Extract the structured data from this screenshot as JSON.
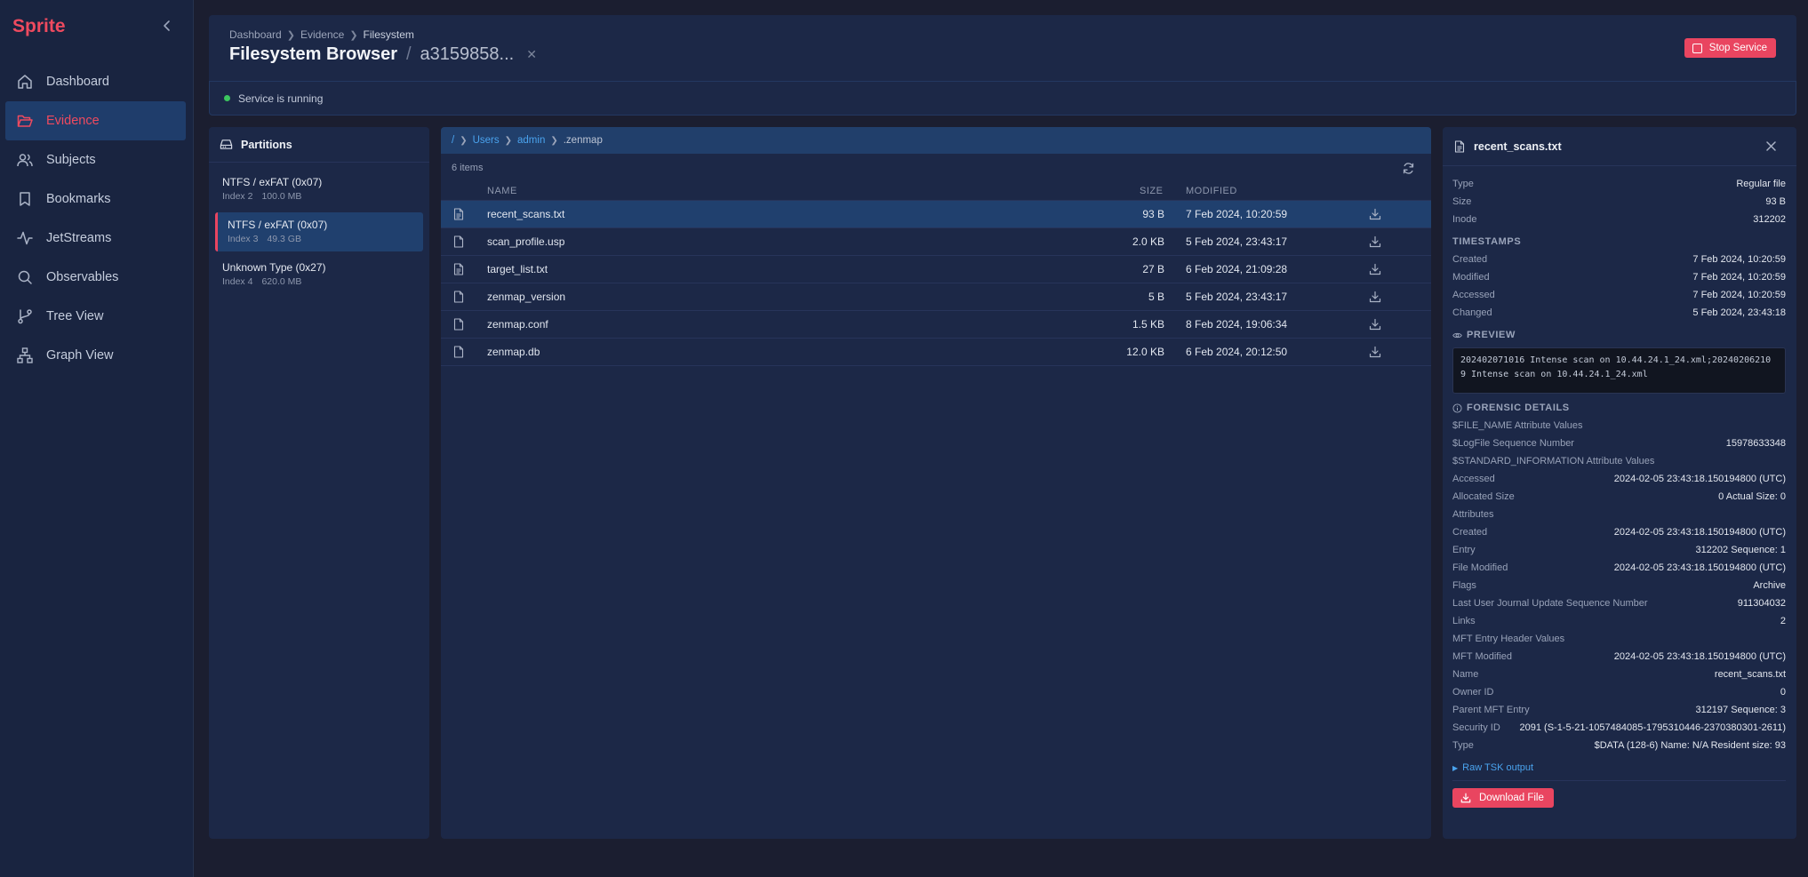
{
  "app": {
    "name": "Sprite"
  },
  "sidebar": {
    "items": [
      {
        "label": "Dashboard",
        "icon": "home-icon"
      },
      {
        "label": "Evidence",
        "icon": "folder-open-icon",
        "active": true
      },
      {
        "label": "Subjects",
        "icon": "users-icon"
      },
      {
        "label": "Bookmarks",
        "icon": "bookmark-icon"
      },
      {
        "label": "JetStreams",
        "icon": "activity-icon"
      },
      {
        "label": "Observables",
        "icon": "search-icon"
      },
      {
        "label": "Tree View",
        "icon": "git-branch-icon"
      },
      {
        "label": "Graph View",
        "icon": "network-icon"
      }
    ]
  },
  "header": {
    "breadcrumb": [
      "Dashboard",
      "Evidence",
      "Filesystem"
    ],
    "title": "Filesystem Browser",
    "evidence_id": "a3159858...",
    "stop_label": "Stop Service"
  },
  "status": {
    "text": "Service is running",
    "color": "#3cc65f"
  },
  "partitions": {
    "title": "Partitions",
    "items": [
      {
        "name": "NTFS / exFAT (0x07)",
        "index": "Index 2",
        "size": "100.0 MB"
      },
      {
        "name": "NTFS / exFAT (0x07)",
        "index": "Index 3",
        "size": "49.3 GB",
        "selected": true
      },
      {
        "name": "Unknown Type (0x27)",
        "index": "Index 4",
        "size": "620.0 MB"
      }
    ]
  },
  "files": {
    "path": {
      "root": "/",
      "segments": [
        "Users",
        "admin"
      ],
      "current": ".zenmap"
    },
    "count": "6 items",
    "columns": {
      "name": "NAME",
      "size": "SIZE",
      "modified": "MODIFIED"
    },
    "rows": [
      {
        "name": "recent_scans.txt",
        "size": "93 B",
        "modified": "7 Feb 2024, 10:20:59",
        "icon": "file-text-icon",
        "selected": true
      },
      {
        "name": "scan_profile.usp",
        "size": "2.0 KB",
        "modified": "5 Feb 2024, 23:43:17",
        "icon": "file-icon"
      },
      {
        "name": "target_list.txt",
        "size": "27 B",
        "modified": "6 Feb 2024, 21:09:28",
        "icon": "file-text-icon"
      },
      {
        "name": "zenmap_version",
        "size": "5 B",
        "modified": "5 Feb 2024, 23:43:17",
        "icon": "file-icon"
      },
      {
        "name": "zenmap.conf",
        "size": "1.5 KB",
        "modified": "8 Feb 2024, 19:06:34",
        "icon": "file-icon"
      },
      {
        "name": "zenmap.db",
        "size": "12.0 KB",
        "modified": "6 Feb 2024, 20:12:50",
        "icon": "file-icon"
      }
    ]
  },
  "details": {
    "filename": "recent_scans.txt",
    "basic": [
      {
        "k": "Type",
        "v": "Regular file"
      },
      {
        "k": "Size",
        "v": "93 B"
      },
      {
        "k": "Inode",
        "v": "312202"
      }
    ],
    "timestamps_title": "TIMESTAMPS",
    "timestamps": [
      {
        "k": "Created",
        "v": "7 Feb 2024, 10:20:59"
      },
      {
        "k": "Modified",
        "v": "7 Feb 2024, 10:20:59"
      },
      {
        "k": "Accessed",
        "v": "7 Feb 2024, 10:20:59"
      },
      {
        "k": "Changed",
        "v": "5 Feb 2024, 23:43:18"
      }
    ],
    "preview_title": "PREVIEW",
    "preview_line1": "202402071016 Intense scan on 10.44.24.1_24.xml;20240206210",
    "preview_line2": "9 Intense scan on 10.44.24.1_24.xml",
    "forensic_title": "FORENSIC DETAILS",
    "forensic": [
      {
        "k": "$FILE_NAME Attribute Values",
        "v": ""
      },
      {
        "k": "$LogFile Sequence Number",
        "v": "15978633348"
      },
      {
        "k": "$STANDARD_INFORMATION Attribute Values",
        "v": ""
      },
      {
        "k": "Accessed",
        "v": "2024-02-05 23:43:18.150194800 (UTC)"
      },
      {
        "k": "Allocated Size",
        "v": "0 Actual Size: 0"
      },
      {
        "k": "Attributes",
        "v": ""
      },
      {
        "k": "Created",
        "v": "2024-02-05 23:43:18.150194800 (UTC)"
      },
      {
        "k": "Entry",
        "v": "312202 Sequence: 1"
      },
      {
        "k": "File Modified",
        "v": "2024-02-05 23:43:18.150194800 (UTC)"
      },
      {
        "k": "Flags",
        "v": "Archive"
      },
      {
        "k": "Last User Journal Update Sequence Number",
        "v": "911304032"
      },
      {
        "k": "Links",
        "v": "2"
      },
      {
        "k": "MFT Entry Header Values",
        "v": ""
      },
      {
        "k": "MFT Modified",
        "v": "2024-02-05 23:43:18.150194800 (UTC)"
      },
      {
        "k": "Name",
        "v": "recent_scans.txt"
      },
      {
        "k": "Owner ID",
        "v": "0"
      },
      {
        "k": "Parent MFT Entry",
        "v": "312197 Sequence: 3"
      },
      {
        "k": "Security ID",
        "v": "2091 (S-1-5-21-1057484085-1795310446-2370380301-2611)"
      },
      {
        "k": "Type",
        "v": "$DATA (128-6) Name: N/A Resident size: 93"
      }
    ],
    "raw_label": "Raw TSK output",
    "download_label": "Download File"
  },
  "colors": {
    "accent": "#e94560",
    "link": "#4aa3ee",
    "selected_bg": "#20406e",
    "panel_bg": "#1c2847"
  }
}
